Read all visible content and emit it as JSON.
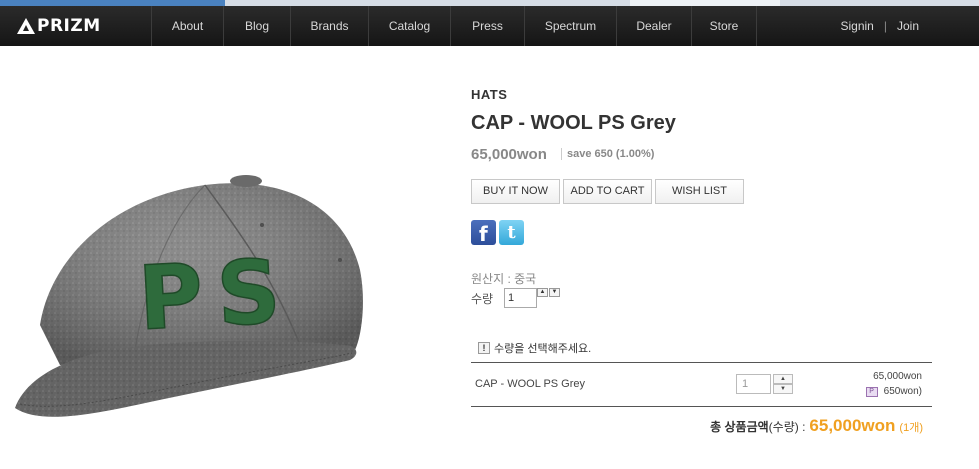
{
  "nav": {
    "logo": "PRIZM",
    "items": [
      "About",
      "Blog",
      "Brands",
      "Catalog",
      "Press",
      "Spectrum",
      "Dealer",
      "Store"
    ],
    "signin": "Signin",
    "divider": "|",
    "join": "Join"
  },
  "product": {
    "category": "HATS",
    "title": "CAP - WOOL PS Grey",
    "price": "65,000won",
    "save": "save 650 (1.00%)",
    "cap_letters": "PS",
    "buttons": {
      "buy_now": "BUY IT NOW",
      "add_to_cart": "ADD TO CART",
      "wish_list": "WISH LIST"
    },
    "social": {
      "facebook_glyph": "f",
      "twitter_glyph": "t"
    },
    "origin": "원산지 : 중국",
    "quantity_label": "수량",
    "quantity_value": "1"
  },
  "notice": {
    "icon_glyph": "!",
    "text": "수량을 선택해주세요."
  },
  "selection": {
    "name": "CAP - WOOL PS Grey",
    "quantity": "1",
    "price": "65,000won",
    "point": "650won)"
  },
  "total": {
    "label": "총 상품금액",
    "paren": "(수량) :",
    "value": "65,000won",
    "count": "(1개)"
  },
  "colors": {
    "nav_bg": "#1e1e1e",
    "price_accent": "#f0a020",
    "cap_felt": "#7a7a7a",
    "cap_letters": "#2e6b3c"
  }
}
